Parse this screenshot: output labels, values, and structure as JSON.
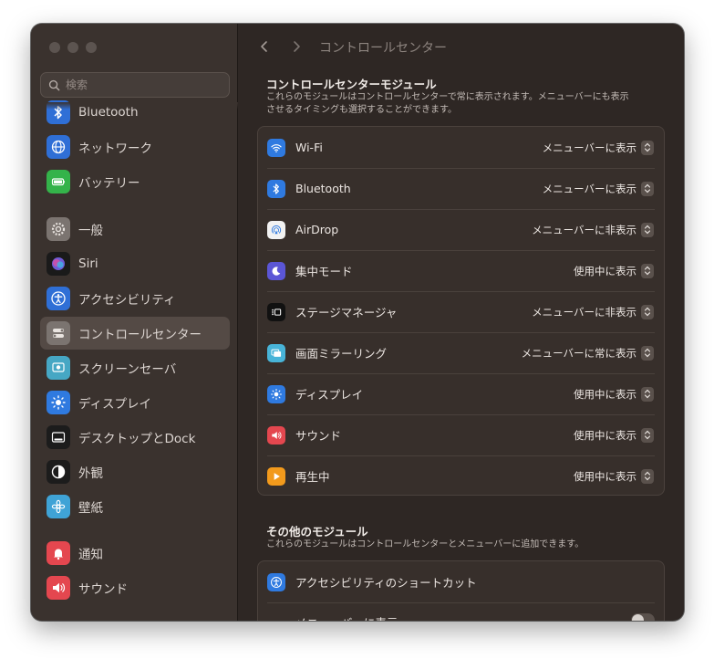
{
  "search": {
    "placeholder": "検索"
  },
  "sidebar": {
    "items": [
      {
        "label": "Bluetooth",
        "icon": "bluetooth-icon",
        "color": "#2f6fd6"
      },
      {
        "label": "ネットワーク",
        "icon": "globe-icon",
        "color": "#2f6fd6"
      },
      {
        "label": "バッテリー",
        "icon": "battery-icon",
        "color": "#34b34a"
      },
      {
        "label": "一般",
        "icon": "gear-icon",
        "color": "#7b7470"
      },
      {
        "label": "Siri",
        "icon": "siri-icon",
        "color": "#1a1a1a"
      },
      {
        "label": "アクセシビリティ",
        "icon": "accessibility-icon",
        "color": "#2f6fd6"
      },
      {
        "label": "コントロールセンター",
        "icon": "control-center-icon",
        "color": "#7b7470"
      },
      {
        "label": "スクリーンセーバ",
        "icon": "screensaver-icon",
        "color": "#46a7c4"
      },
      {
        "label": "ディスプレイ",
        "icon": "sun-icon",
        "color": "#2f7ae0"
      },
      {
        "label": "デスクトップとDock",
        "icon": "dock-icon",
        "color": "#1c1c1c"
      },
      {
        "label": "外観",
        "icon": "appearance-icon",
        "color": "#1c1c1c"
      },
      {
        "label": "壁紙",
        "icon": "wallpaper-icon",
        "color": "#3fa3d6"
      },
      {
        "label": "通知",
        "icon": "bell-icon",
        "color": "#e4474f"
      },
      {
        "label": "サウンド",
        "icon": "speaker-icon",
        "color": "#e4474f"
      }
    ]
  },
  "header": {
    "title": "コントロールセンター"
  },
  "modules": {
    "title": "コントロールセンターモジュール",
    "desc1": "これらのモジュールはコントロールセンターで常に表示されます。メニューバーにも表示",
    "desc2": "させるタイミングも選択することができます。",
    "rows": [
      {
        "label": "Wi-Fi",
        "value": "メニューバーに表示",
        "icon": "wifi-icon",
        "color": "#2f7ae0"
      },
      {
        "label": "Bluetooth",
        "value": "メニューバーに表示",
        "icon": "bluetooth-icon",
        "color": "#2f7ae0"
      },
      {
        "label": "AirDrop",
        "value": "メニューバーに非表示",
        "icon": "airdrop-icon",
        "color": "#f2f2f2"
      },
      {
        "label": "集中モード",
        "value": "使用中に表示",
        "icon": "moon-icon",
        "color": "#5b56d6"
      },
      {
        "label": "ステージマネージャ",
        "value": "メニューバーに非表示",
        "icon": "stage-manager-icon",
        "color": "#111111"
      },
      {
        "label": "画面ミラーリング",
        "value": "メニューバーに常に表示",
        "icon": "screen-mirroring-icon",
        "color": "#48b4d8"
      },
      {
        "label": "ディスプレイ",
        "value": "使用中に表示",
        "icon": "sun-icon",
        "color": "#2f7ae0"
      },
      {
        "label": "サウンド",
        "value": "使用中に表示",
        "icon": "speaker-icon",
        "color": "#e4474f"
      },
      {
        "label": "再生中",
        "value": "使用中に表示",
        "icon": "play-icon",
        "color": "#f29a1c"
      }
    ]
  },
  "other": {
    "title": "その他のモジュール",
    "desc": "これらのモジュールはコントロールセンターとメニューバーに追加できます。",
    "rows": [
      {
        "label": "アクセシビリティのショートカット",
        "icon": "accessibility-icon",
        "color": "#2f7ae0"
      },
      {
        "label": "メニューバーに表示",
        "toggle": false
      }
    ]
  }
}
